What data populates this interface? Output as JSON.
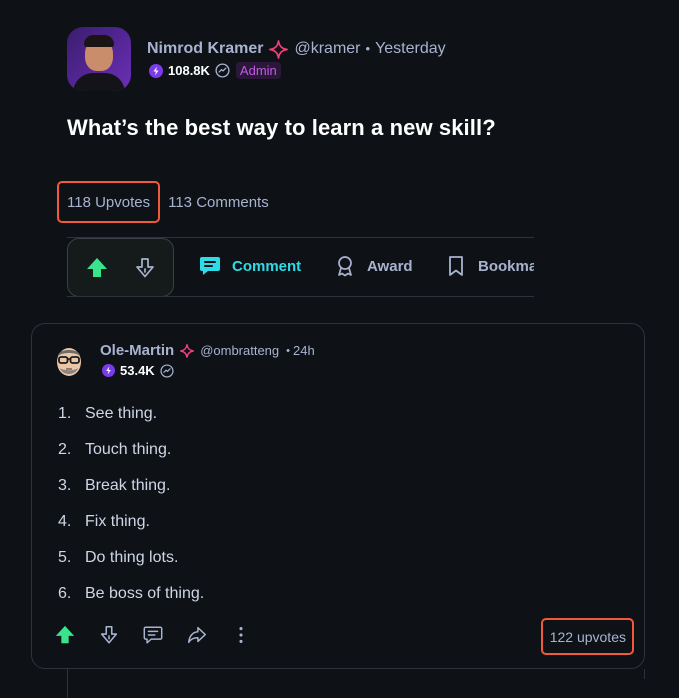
{
  "post": {
    "author": {
      "name": "Nimrod Kramer",
      "handle": "@kramer",
      "separator": "•",
      "time": "Yesterday",
      "reputation": "108.8K",
      "badge": "Admin"
    },
    "title": "What’s the best way to learn a new skill?",
    "stats": {
      "upvotes": "118 Upvotes",
      "comments": "113 Comments"
    },
    "actions": {
      "comment": "Comment",
      "award": "Award",
      "bookmark": "Bookmark"
    }
  },
  "comment": {
    "author": {
      "name": "Ole-Martin",
      "handle": "@ombratteng",
      "separator": "•",
      "time": "24h",
      "reputation": "53.4K"
    },
    "items": [
      {
        "num": "1.",
        "text": "See thing."
      },
      {
        "num": "2.",
        "text": "Touch thing."
      },
      {
        "num": "3.",
        "text": "Break thing."
      },
      {
        "num": "4.",
        "text": "Fix thing."
      },
      {
        "num": "5.",
        "text": "Do thing lots."
      },
      {
        "num": "6.",
        "text": "Be boss of thing."
      }
    ],
    "upvotes": "122 upvotes"
  },
  "colors": {
    "background": "#0e1217",
    "upvote_active": "#39e58c",
    "comment_accent": "#2cdce6",
    "sparkle": "#f0427a",
    "reputation": "#7c3aed",
    "admin_badge": "#c25be8",
    "highlight_border": "#f05a3a"
  },
  "icons": {
    "upvote": "upvote-arrow-icon",
    "downvote": "downvote-arrow-icon",
    "comment": "comment-bubble-icon",
    "award": "award-medal-icon",
    "bookmark": "bookmark-icon",
    "share": "share-arrow-icon",
    "more": "more-vertical-icon"
  }
}
